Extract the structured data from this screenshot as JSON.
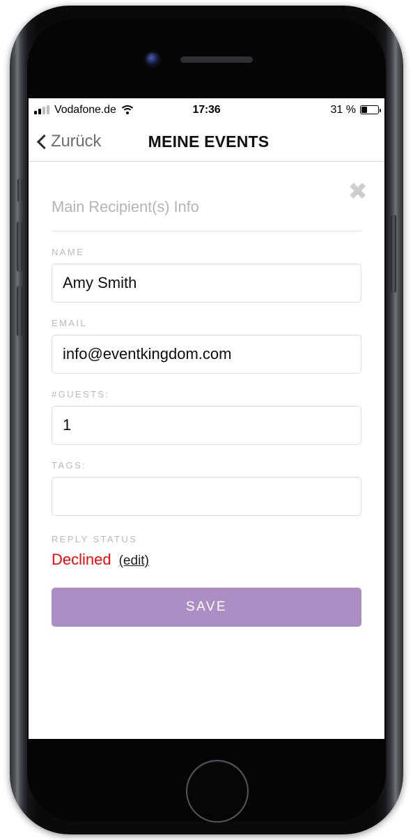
{
  "status_bar": {
    "carrier": "Vodafone.de",
    "time": "17:36",
    "battery_percent": "31 %",
    "battery_level": 31,
    "signal_icon": "signal-bars-icon",
    "wifi_icon": "wifi-icon",
    "battery_icon": "battery-icon"
  },
  "nav": {
    "back_label": "Zurück",
    "back_icon": "chevron-left-icon",
    "title": "MEINE EVENTS"
  },
  "card": {
    "close_icon": "close-icon",
    "close_glyph": "✖",
    "section_title": "Main Recipient(s) Info"
  },
  "fields": [
    {
      "label": "NAME",
      "value": "Amy Smith",
      "placeholder": ""
    },
    {
      "label": "EMAIL",
      "value": "info@eventkingdom.com",
      "placeholder": ""
    },
    {
      "label": "#GUESTS:",
      "value": "1",
      "placeholder": ""
    },
    {
      "label": "TAGS:",
      "value": "",
      "placeholder": ""
    }
  ],
  "reply_status": {
    "label": "REPLY STATUS",
    "value": "Declined",
    "edit_label": "(edit)",
    "value_color": "#f40606"
  },
  "actions": {
    "save_label": "SAVE",
    "save_color": "#ac8ec4"
  },
  "device": {
    "camera_icon": "front-camera-icon",
    "earpiece_icon": "earpiece-speaker-icon",
    "home_button_icon": "home-button-icon",
    "volume_up_icon": "volume-up-button",
    "volume_down_icon": "volume-down-button",
    "power_icon": "power-button",
    "silent_icon": "silent-switch"
  }
}
